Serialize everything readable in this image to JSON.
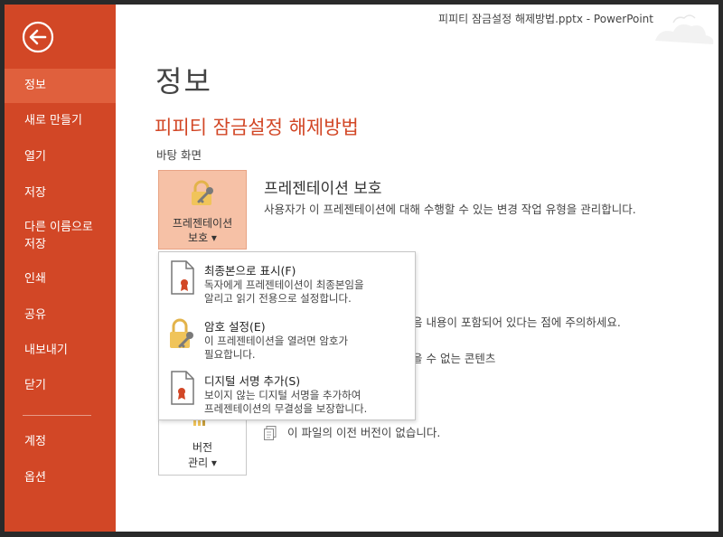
{
  "window": {
    "title": "피피티 잠금설정 해제방법.pptx - PowerPoint"
  },
  "sidebar": {
    "items": [
      {
        "label": "정보",
        "active": true
      },
      {
        "label": "새로 만들기"
      },
      {
        "label": "열기"
      },
      {
        "label": "저장"
      },
      {
        "label": "다른 이름으로\n저장"
      },
      {
        "label": "인쇄"
      },
      {
        "label": "공유"
      },
      {
        "label": "내보내기"
      },
      {
        "label": "닫기"
      },
      {
        "label": "계정"
      },
      {
        "label": "옵션"
      }
    ]
  },
  "main": {
    "page_title": "정보",
    "file_name": "피피티 잠금설정 해제방법",
    "file_location": "바탕 화면",
    "protect": {
      "button_line1": "프레젠테이션",
      "button_line2": "보호 ▾",
      "title": "프레젠테이션 보호",
      "description": "사용자가 이 프레젠테이션에 대해 수행할 수 있는 변경 작업 유형을 관리합니다."
    },
    "inspect_fragment": "음 내용이 포함되어 있다는 점에 주의하세요.",
    "inspect_fragment2": "을 수 없는 콘텐츠",
    "versions": {
      "button_line1": "버전",
      "button_line2": "관리 ▾",
      "note": "이 파일의 이전 버전이 없습니다."
    }
  },
  "dropdown": {
    "items": [
      {
        "title": "최종본으로 표시(F)",
        "description": "독자에게 프레젠테이션이 최종본임을\n알리고 읽기 전용으로 설정합니다.",
        "icon": "final-document-icon"
      },
      {
        "title": "암호 설정(E)",
        "description": "이 프레젠테이션을 열려면 암호가\n필요합니다.",
        "icon": "lock-key-icon"
      },
      {
        "title": "디지털 서명 추가(S)",
        "description": "보이지 않는 디지털 서명을 추가하여\n프레젠테이션의 무결성을 보장합니다.",
        "icon": "signature-document-icon"
      }
    ]
  },
  "colors": {
    "accent": "#d24726",
    "sidebar_active": "#e0603d",
    "protect_button_bg": "#f6c1a6"
  }
}
